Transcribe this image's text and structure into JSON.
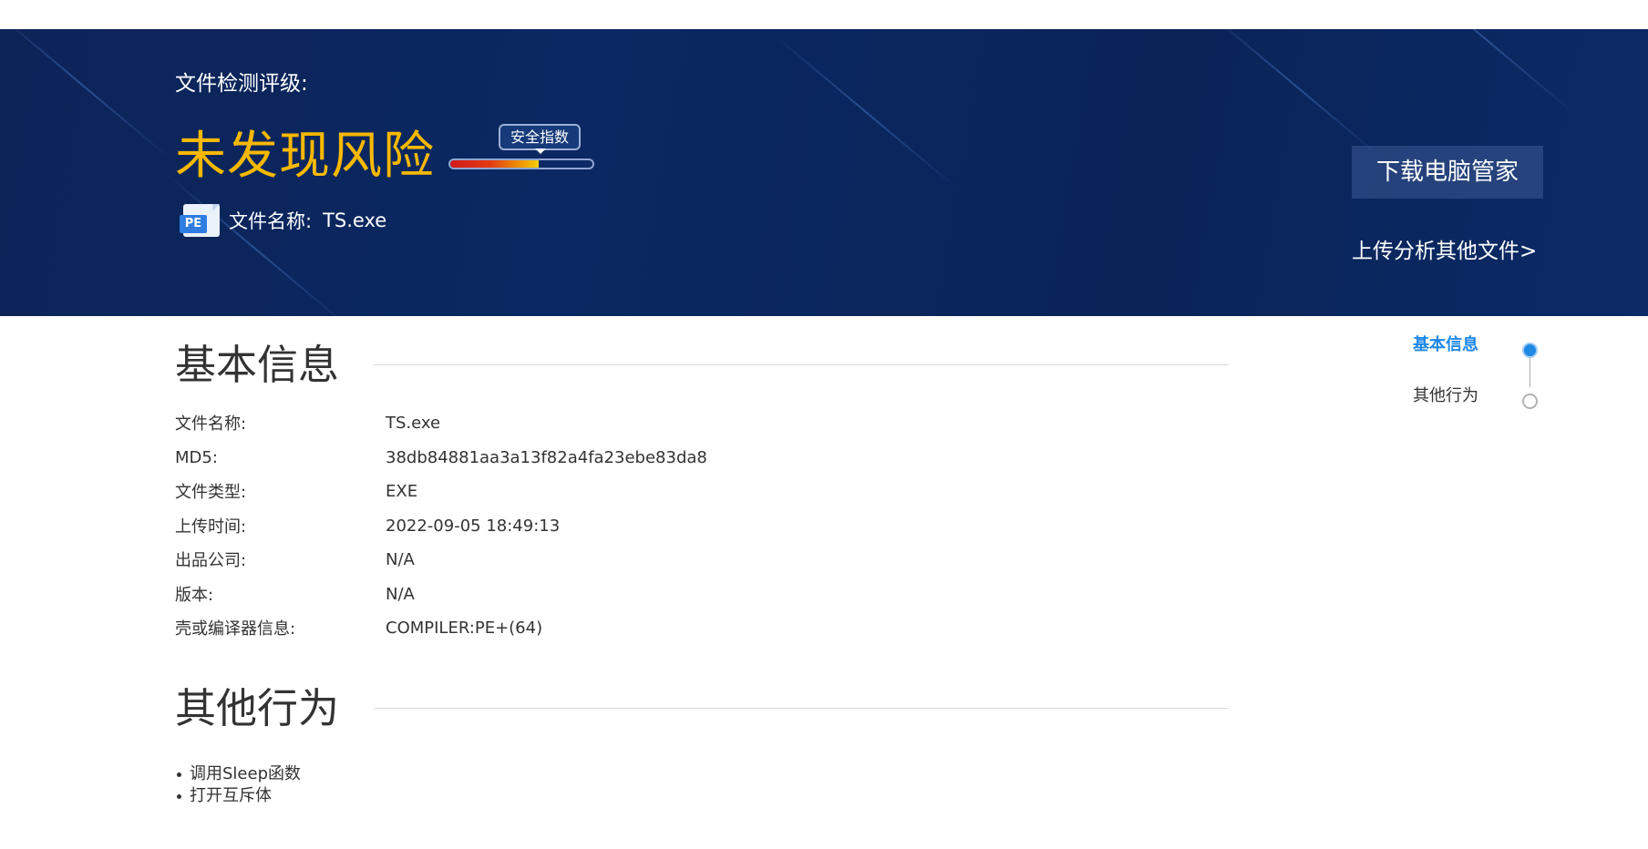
{
  "hero": {
    "rating_label": "文件检测评级:",
    "risk_text": "未发现风险",
    "gauge_label": "安全指数",
    "gauge_fill_percent": 62,
    "file_icon_label": "PE",
    "file_name_label": "文件名称:",
    "file_name_value": "TS.exe",
    "download_button": "下载电脑管家",
    "upload_link": "上传分析其他文件>"
  },
  "basic_info": {
    "title": "基本信息",
    "rows": [
      {
        "key": "文件名称:",
        "value": "TS.exe"
      },
      {
        "key": "MD5:",
        "value": "38db84881aa3a13f82a4fa23ebe83da8"
      },
      {
        "key": "文件类型:",
        "value": "EXE"
      },
      {
        "key": "上传时间:",
        "value": "2022-09-05 18:49:13"
      },
      {
        "key": "出品公司:",
        "value": "N/A"
      },
      {
        "key": "版本:",
        "value": "N/A"
      },
      {
        "key": "壳或编译器信息:",
        "value": "COMPILER:PE+(64)"
      }
    ]
  },
  "other_behavior": {
    "title": "其他行为",
    "items": [
      "调用Sleep函数",
      "打开互斥体"
    ]
  },
  "side_nav": {
    "items": [
      {
        "label": "基本信息",
        "active": true
      },
      {
        "label": "其他行为",
        "active": false
      }
    ]
  },
  "colors": {
    "hero_bg": "#0b2660",
    "risk_color": "#f6b800",
    "accent": "#1e88e5"
  }
}
